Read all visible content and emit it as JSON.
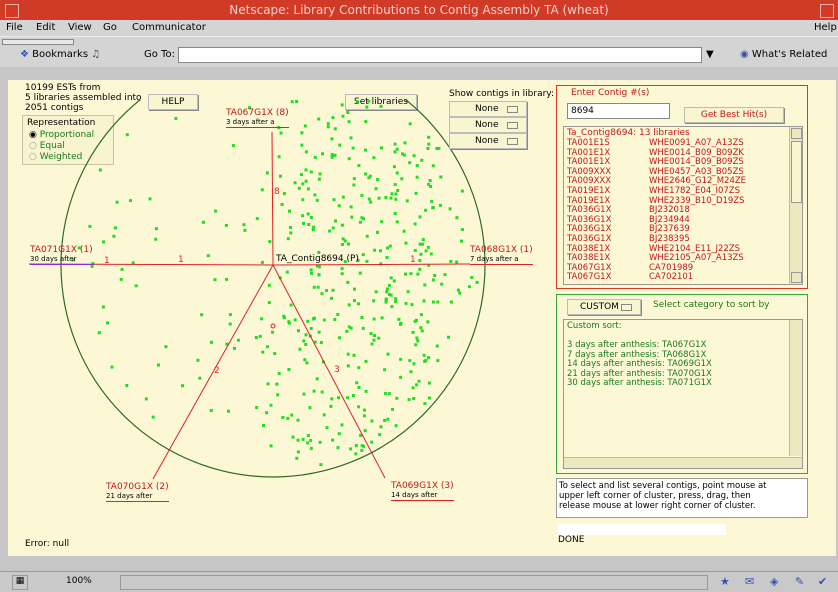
{
  "window": {
    "title": "Netscape: Library Contributions to Contig Assembly TA (wheat)"
  },
  "menu": {
    "file": "File",
    "edit": "Edit",
    "view": "View",
    "go": "Go",
    "communicator": "Communicator",
    "help": "Help"
  },
  "toolbar": {
    "bookmarks": "Bookmarks",
    "goto": "Go To:",
    "url": "",
    "whats_related": "What's Related"
  },
  "left": {
    "summary": [
      "10199 ESTs from",
      "5 libraries assembled into",
      "2051 contigs"
    ],
    "help_button": "HELP",
    "set_libraries_button": "Set libraries",
    "representation": {
      "title": "Representation",
      "options": [
        "Proportional",
        "Equal",
        "Weighted"
      ],
      "selected": "Proportional"
    },
    "error": "Error: null"
  },
  "plot": {
    "center_label": "TA_Contig8694 (P)",
    "center_number": "1",
    "libraries": [
      {
        "id": "TA067G1X (8)",
        "desc": "3 days after a",
        "number": "8"
      },
      {
        "id": "TA068G1X (1)",
        "desc": "7 days after a",
        "number": "1"
      },
      {
        "id": "TA069G1X (3)",
        "desc": "14 days after",
        "number": "3"
      },
      {
        "id": "TA070G1X (2)",
        "desc": "21 days after",
        "number": "2"
      },
      {
        "id": "TA071G1X (1)",
        "desc": "30 days after",
        "number": "1"
      }
    ]
  },
  "show_contigs": {
    "label": "Show contigs in library:",
    "selects": [
      "None",
      "None",
      "None"
    ]
  },
  "contig_panel": {
    "label": "Enter Contig #(s)",
    "input_value": "8694",
    "button": "Get Best Hit(s)",
    "header": "Ta_Contig8694: 13 libraries",
    "rows": [
      [
        "TA001E1S",
        "WHE0091_A07_A13ZS"
      ],
      [
        "TA001E1X",
        "WHE0014_B09_B09ZK"
      ],
      [
        "TA001E1X",
        "WHE0014_B09_B09ZS"
      ],
      [
        "TA009XXX",
        "WHE0457_A03_B05ZS"
      ],
      [
        "TA009XXX",
        "WHE2646_G12_M24ZE"
      ],
      [
        "TA019E1X",
        "WHE1782_E04_I07ZS"
      ],
      [
        "TA019E1X",
        "WHE2339_B10_D19ZS"
      ],
      [
        "TA036G1X",
        "BJ232018"
      ],
      [
        "TA036G1X",
        "BJ234944"
      ],
      [
        "TA036G1X",
        "BJ237639"
      ],
      [
        "TA036G1X",
        "BJ238395"
      ],
      [
        "TA038E1X",
        "WHE2104_E11_J22ZS"
      ],
      [
        "TA038E1X",
        "WHE2105_A07_A13ZS"
      ],
      [
        "TA067G1X",
        "CA701989"
      ],
      [
        "TA067G1X",
        "CA702101"
      ]
    ]
  },
  "sort_panel": {
    "select": "CUSTOM",
    "label": "Select category to sort by",
    "lines": [
      "Custom sort:",
      "",
      "3 days after anthesis: TA067G1X",
      "7 days after anthesis: TA068G1X",
      "14 days after anthesis: TA069G1X",
      "21 days after anthesis: TA070G1X",
      "30 days after anthesis: TA071G1X"
    ]
  },
  "instructions": [
    "To select and list several contigs, point mouse at",
    "upper left corner of cluster, press, drag, then",
    "release mouse at lower right corner of cluster."
  ],
  "done": "DONE",
  "status": {
    "zoom": "100%"
  },
  "colors": {
    "title_bar": "#d23a28",
    "page_bg": "#fcf8d6",
    "circle": "#2e6b1e",
    "points": "#22dd22",
    "lines": "#dd2222",
    "label_red": "#c21818"
  }
}
